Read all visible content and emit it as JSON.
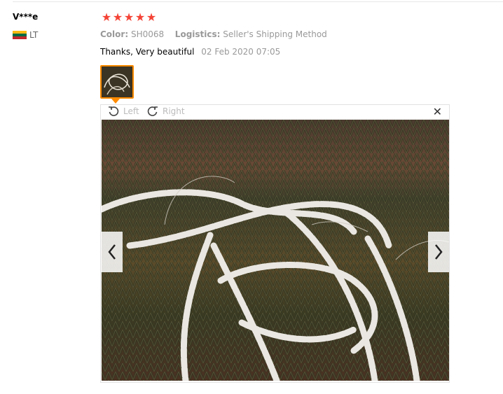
{
  "review": {
    "user_name": "V***e",
    "country_code": "LT",
    "flag_colors": [
      "#fdb913",
      "#006a44",
      "#c1272d"
    ],
    "stars": 5,
    "star_color": "#f44336",
    "color_label": "Color:",
    "color_value": "SH0068",
    "logistics_label": "Logistics:",
    "logistics_value": "Seller's Shipping Method",
    "text": "Thanks, Very beautiful",
    "date": "02 Feb 2020 07:05"
  },
  "viewer": {
    "rotate_left_label": "Left",
    "rotate_right_label": "Right",
    "close_symbol": "✕",
    "image_description_icon": "pearl-bead-strands-photo",
    "accent_color": "#ff8a00"
  }
}
